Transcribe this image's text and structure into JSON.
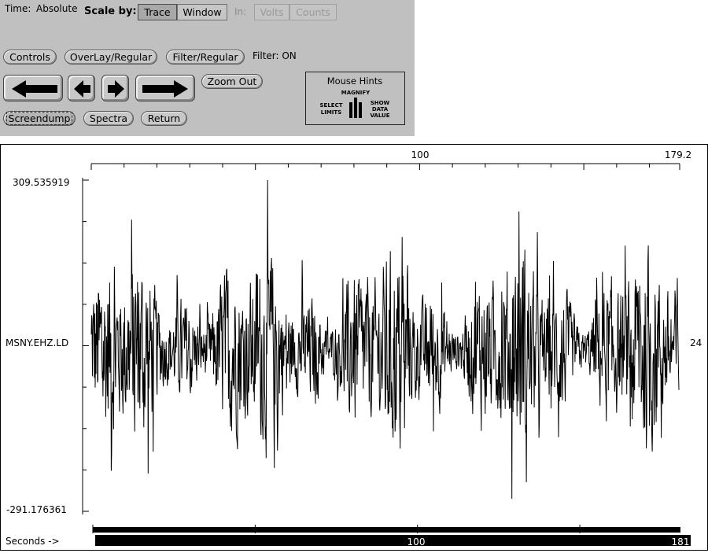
{
  "controls": {
    "time_label": "Time:",
    "time_value": "Absolute",
    "scale_label": "Scale by:",
    "scale_options": [
      "Trace",
      "Window"
    ],
    "scale_selected": "Trace",
    "in_label": "In:",
    "unit_options": [
      "Volts",
      "Counts"
    ],
    "buttons": {
      "controls": "Controls",
      "overlay": "OverLay/Regular",
      "filter": "Filter/Regular",
      "zoom_out": "Zoom Out",
      "screendump": "Screendump",
      "spectra": "Spectra",
      "return": "Return"
    },
    "filter_status": "Filter: ON",
    "nav_icons": [
      "arrow-left-large-icon",
      "arrow-left-small-icon",
      "arrow-right-small-icon",
      "arrow-right-large-icon"
    ]
  },
  "mouse_hints": {
    "title": "Mouse Hints",
    "magnify": "MAGNIFY",
    "select_limits": [
      "SELECT",
      "LIMITS"
    ],
    "show_data_value": [
      "SHOW",
      "DATA",
      "VALUE"
    ]
  },
  "plot": {
    "channel": "MSNY.EHZ.LD",
    "right_label": "24",
    "y_max_label": "309.535919",
    "y_min_label": "-291.176361",
    "top_ticks": [
      "100",
      "179.2"
    ],
    "bottom_ticks": [
      "100",
      "181"
    ],
    "x_axis_label": "Seconds ->"
  },
  "chart_data": {
    "type": "line",
    "title": "",
    "series": [
      {
        "name": "MSNY.EHZ.LD",
        "count_samples": 0
      }
    ],
    "ylim": [
      -291.176361,
      309.535919
    ],
    "xlim_top": [
      0,
      179.2
    ],
    "xlim_bottom": [
      0,
      181
    ],
    "xlabel": "Seconds ->",
    "grid": false,
    "legend": "none"
  }
}
